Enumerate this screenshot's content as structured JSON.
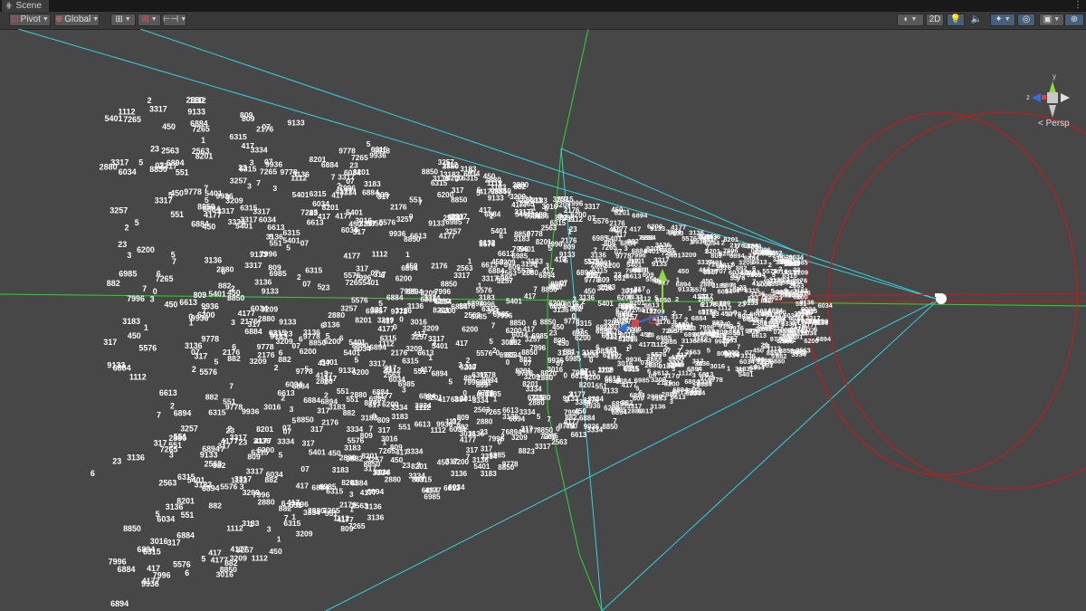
{
  "tab": {
    "title": "Scene",
    "icon": "grid-icon"
  },
  "toolbar": {
    "pivot_label": "Pivot",
    "global_label": "Global",
    "mode_2d_label": "2D"
  },
  "gizmo": {
    "y_label": "y",
    "z_label": "z",
    "projection_label": "< Persp"
  },
  "colors": {
    "background": "#474747",
    "frustum": "#32d2e0",
    "axis_green": "#2ed62e",
    "light_red": "#c01c1c",
    "labels": "#ffffff"
  },
  "scene_labels": [
    "6894",
    "317",
    "3334",
    "6985",
    "882",
    "8201",
    "7265",
    "6034",
    "417",
    "5576",
    "9778",
    "450",
    "6315",
    "2880",
    "8850",
    "7",
    "23",
    "3016",
    "6200",
    "3257",
    "9133",
    "3136",
    "3183",
    "3317",
    "5401",
    "1112",
    "809",
    "7996",
    "07",
    "551",
    "3209",
    "2176",
    "2563",
    "6613",
    "9936",
    "4177",
    "6884",
    "3",
    "2",
    "1",
    "0",
    "5",
    "6"
  ]
}
